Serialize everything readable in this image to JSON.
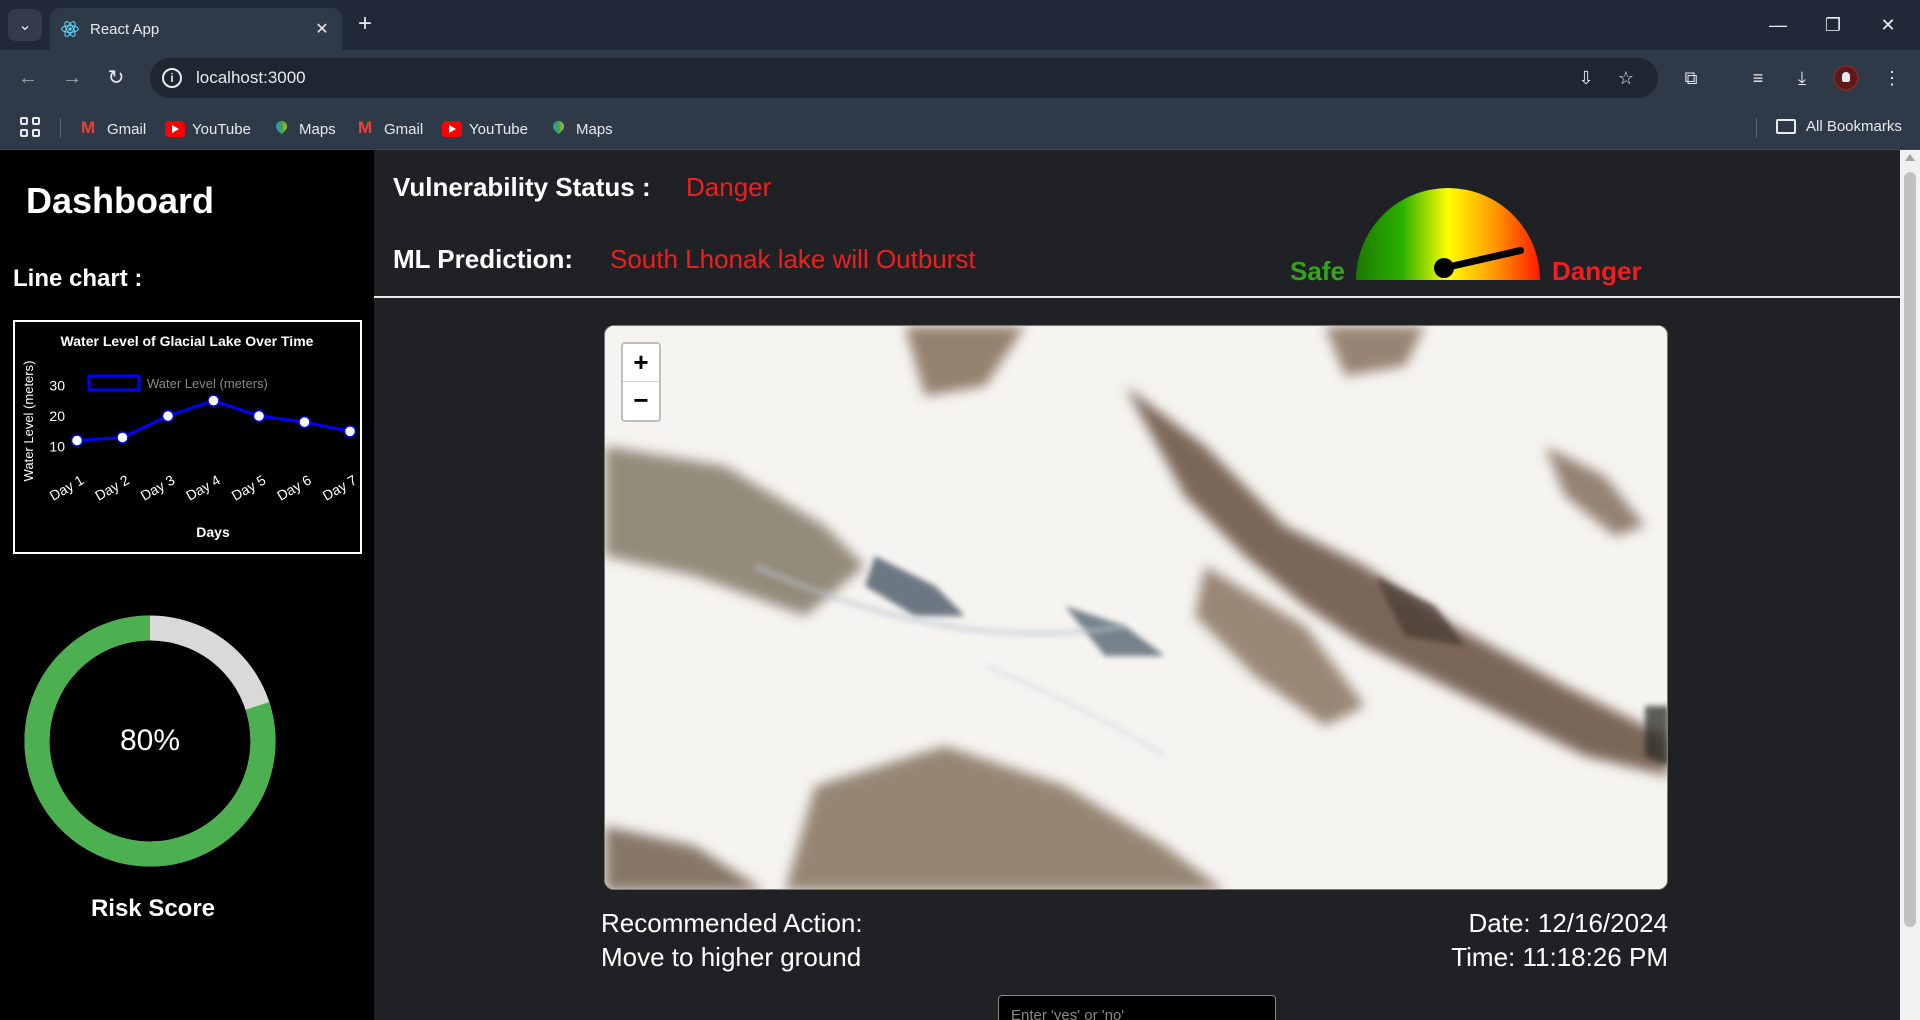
{
  "browser": {
    "tab_title": "React App",
    "url": "localhost:3000",
    "bookmarks": [
      "Gmail",
      "YouTube",
      "Maps",
      "Gmail",
      "YouTube",
      "Maps"
    ],
    "all_bookmarks": "All Bookmarks"
  },
  "sidebar": {
    "title": "Dashboard",
    "line_chart_label": "Line chart :",
    "risk_score_label": "Risk Score",
    "risk_percent_text": "80%",
    "risk_fraction": 0.8
  },
  "chart_data": {
    "type": "line",
    "title": "Water Level of Glacial Lake Over Time",
    "xlabel": "Days",
    "ylabel": "Water Level (meters)",
    "categories": [
      "Day 1",
      "Day 2",
      "Day 3",
      "Day 4",
      "Day 5",
      "Day 6",
      "Day 7"
    ],
    "series": [
      {
        "name": "Water Level (meters)",
        "values": [
          12,
          13,
          20,
          25,
          20,
          18,
          15
        ]
      }
    ],
    "ylim": [
      5,
      35
    ],
    "yticks": [
      10,
      20,
      30
    ],
    "legend": "top",
    "grid": false,
    "colors": {
      "line": "#0000ff",
      "point": "#ffffff"
    }
  },
  "header": {
    "status_key": "Vulnerability Status :",
    "status_value": "Danger",
    "prediction_key": "ML Prediction:",
    "prediction_value": "South Lhonak lake will Outburst",
    "gauge_safe": "Safe",
    "gauge_danger": "Danger",
    "gauge_level": 0.85
  },
  "map": {
    "zoom_in": "+",
    "zoom_out": "−"
  },
  "footer": {
    "recommended_key": "Recommended Action:",
    "recommended_value": "Move to higher ground",
    "date": "Date: 12/16/2024",
    "time": "Time: 11:18:26 PM",
    "answer_placeholder": "Enter 'yes' or 'no'"
  },
  "colors": {
    "danger": "#f01f1f",
    "safe": "#33a51a",
    "risk_ring": "#4caf50",
    "risk_track": "#d9d9d9"
  }
}
